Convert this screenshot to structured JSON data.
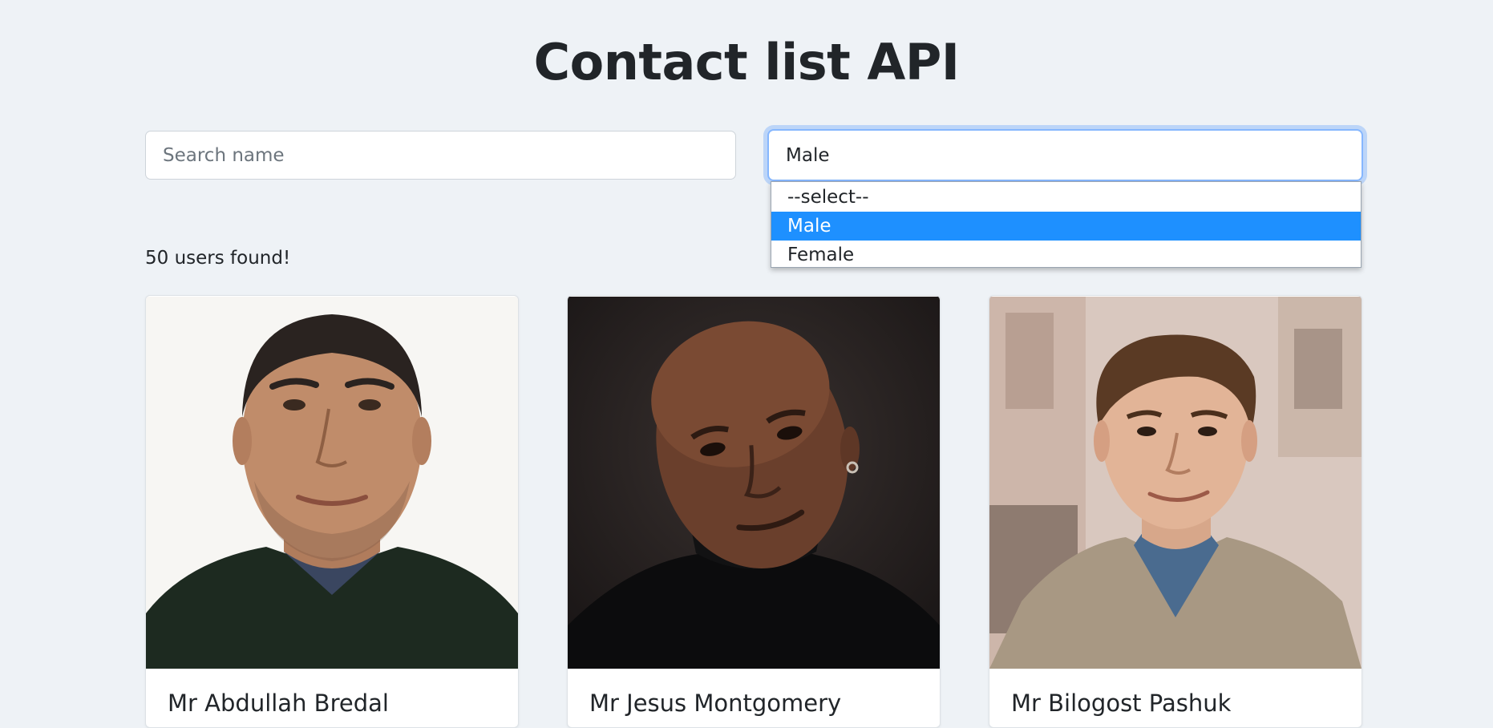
{
  "header": {
    "title": "Contact list API"
  },
  "filters": {
    "search_placeholder": "Search name",
    "search_value": "",
    "gender_selected": "Male",
    "gender_options": [
      "--select--",
      "Male",
      "Female"
    ]
  },
  "results": {
    "count_text": "50 users found!"
  },
  "cards": [
    {
      "name": "Mr Abdullah Bredal",
      "photo": "portrait-photo"
    },
    {
      "name": "Mr Jesus Montgomery",
      "photo": "portrait-photo"
    },
    {
      "name": "Mr Bilogost Pashuk",
      "photo": "portrait-photo"
    }
  ],
  "colors": {
    "background": "#eef2f6",
    "focus_ring": "#86b7fe",
    "option_highlight": "#1e90ff"
  }
}
